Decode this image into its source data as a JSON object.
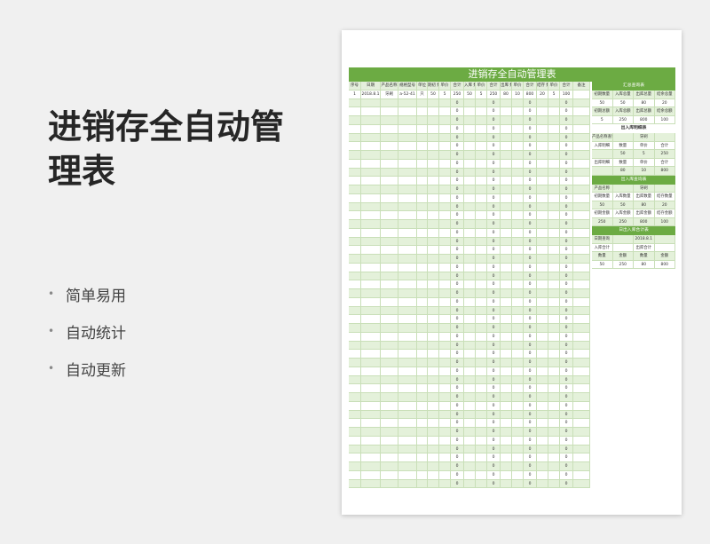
{
  "slide": {
    "title": "进销存全自动管理表",
    "bullets": [
      "简单易用",
      "自动统计",
      "自动更新"
    ]
  },
  "sheet": {
    "banner": "进销存全自动管理表",
    "headers": [
      "序号",
      "日期",
      "产品名称",
      "规格型号",
      "单位",
      "期初\n数量",
      "单价",
      "合计",
      "入库\n数量",
      "单价",
      "合计",
      "出库\n数量",
      "单价",
      "合计",
      "结存\n数量",
      "单价",
      "合计",
      "备注"
    ],
    "first_row": [
      "1",
      "2018.8.1",
      "牙刷",
      "a-52-41",
      "只",
      "50",
      "5",
      "250",
      "50",
      "5",
      "250",
      "80",
      "10",
      "800",
      "20",
      "5",
      "100",
      ""
    ],
    "empty_row_total": "0",
    "empty_rows": 45
  },
  "side": {
    "summary": {
      "bar": "汇总查询表",
      "rows": [
        [
          "初期数量",
          "入库总量",
          "出库总量",
          "结余总量"
        ],
        [
          "50",
          "50",
          "80",
          "20"
        ],
        [
          "初期总额",
          "入库总额",
          "出库总额",
          "结余总额"
        ],
        [
          "5",
          "250",
          "800",
          "100"
        ]
      ]
    },
    "detail": {
      "caption": "出入库明细表",
      "rows": [
        [
          "产品名称查询",
          "",
          "牙刷",
          ""
        ],
        [
          "入库明细",
          "数量",
          "单价",
          "合计"
        ],
        [
          "",
          "50",
          "5",
          "250"
        ],
        [
          "出库明细",
          "数量",
          "单价",
          "合计"
        ],
        [
          "",
          "80",
          "10",
          "800"
        ]
      ]
    },
    "query": {
      "bar": "出入库查询表",
      "rows": [
        [
          "产品名称",
          "",
          "牙刷",
          ""
        ],
        [
          "初期数量",
          "入库数量",
          "出库数量",
          "结存数量"
        ],
        [
          "50",
          "50",
          "80",
          "20"
        ],
        [
          "初期金额",
          "入库金额",
          "出库金额",
          "结存金额"
        ],
        [
          "250",
          "250",
          "800",
          "100"
        ]
      ]
    },
    "daily": {
      "bar": "日出入库合计表",
      "rows": [
        [
          "日期查询",
          "",
          "2018.8.1",
          ""
        ],
        [
          "入库合计",
          "",
          "出库合计",
          ""
        ],
        [
          "数量",
          "金额",
          "数量",
          "金额"
        ],
        [
          "50",
          "250",
          "80",
          "800"
        ]
      ]
    }
  }
}
